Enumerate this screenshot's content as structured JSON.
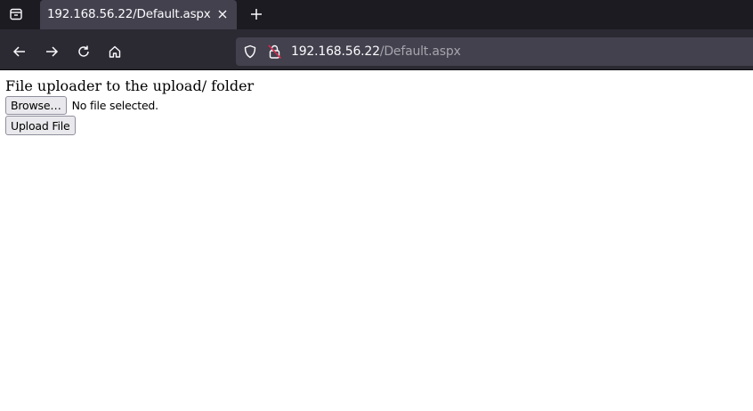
{
  "browser": {
    "tab": {
      "title": "192.168.56.22/Default.aspx"
    },
    "url": {
      "host": "192.168.56.22",
      "path": "/Default.aspx"
    },
    "icons": {
      "tab_list": "tab-list-icon",
      "close": "close-icon",
      "new_tab": "plus-icon",
      "back": "arrow-left-icon",
      "forward": "arrow-right-icon",
      "reload": "reload-icon",
      "home": "home-icon",
      "tracking_protection": "shield-icon",
      "insecure": "insecure-lock-icon"
    },
    "colors": {
      "tabstrip": "#1c1b22",
      "toolbar": "#2b2a33",
      "urlbar": "#42414d",
      "insecure_slash": "#e22850"
    }
  },
  "page": {
    "heading": "File uploader to the upload/ folder",
    "file_input": {
      "browse_label": "Browse…",
      "status": "No file selected."
    },
    "upload_button": "Upload File"
  }
}
